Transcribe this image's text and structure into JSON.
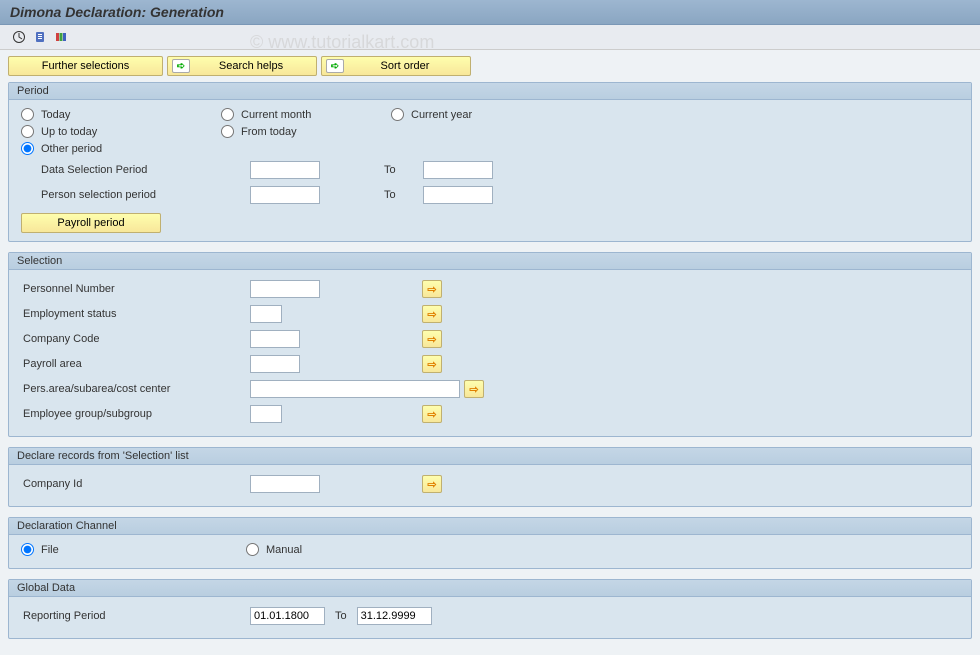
{
  "header": {
    "title": "Dimona Declaration: Generation"
  },
  "watermark": "© www.tutorialkart.com",
  "toolbar_icons": {
    "execute": "execute",
    "info": "info",
    "colors": "colors"
  },
  "action_buttons": {
    "further": "Further selections",
    "search": "Search helps",
    "sort": "Sort order"
  },
  "period": {
    "title": "Period",
    "today": "Today",
    "current_month": "Current month",
    "current_year": "Current year",
    "up_to_today": "Up to today",
    "from_today": "From today",
    "other_period": "Other period",
    "data_sel": "Data Selection Period",
    "person_sel": "Person selection period",
    "to": "To",
    "payroll_btn": "Payroll period",
    "data_from": "",
    "data_to": "",
    "person_from": "",
    "person_to": ""
  },
  "selection": {
    "title": "Selection",
    "personnel": "Personnel Number",
    "emp_status": "Employment status",
    "company_code": "Company Code",
    "payroll_area": "Payroll area",
    "pers_area": "Pers.area/subarea/cost center",
    "emp_group": "Employee group/subgroup",
    "v_personnel": "",
    "v_emp_status": "",
    "v_company_code": "",
    "v_payroll_area": "",
    "v_pers_area": "",
    "v_emp_group": ""
  },
  "declare": {
    "title": "Declare records from 'Selection' list",
    "company_id": "Company Id",
    "v_company": ""
  },
  "channel": {
    "title": "Declaration Channel",
    "file": "File",
    "manual": "Manual"
  },
  "global": {
    "title": "Global Data",
    "reporting": "Reporting Period",
    "to": "To",
    "from_val": "01.01.1800",
    "to_val": "31.12.9999"
  }
}
